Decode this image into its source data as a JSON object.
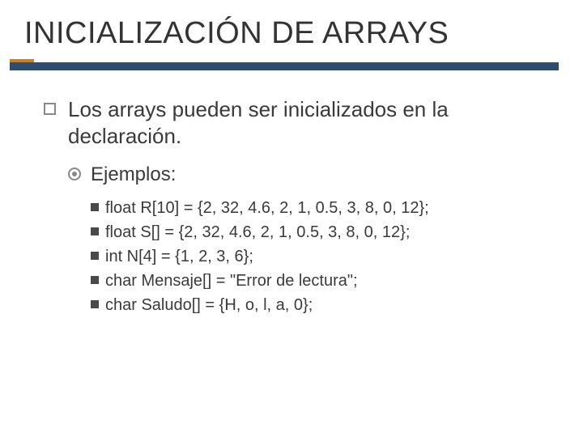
{
  "title": "INICIALIZACIÓN DE ARRAYS",
  "intro": "Los arrays pueden ser inicializados en la declaración.",
  "examples_label": "Ejemplos:",
  "examples": [
    "float R[10] = {2, 32, 4.6, 2, 1, 0.5, 3, 8, 0, 12};",
    "float S[] = {2, 32, 4.6, 2, 1, 0.5, 3, 8, 0, 12};",
    "int N[4] = {1, 2, 3, 6};",
    "char Mensaje[] = \"Error de lectura\";",
    "char Saludo[] = {H, o, l, a, 0};"
  ]
}
